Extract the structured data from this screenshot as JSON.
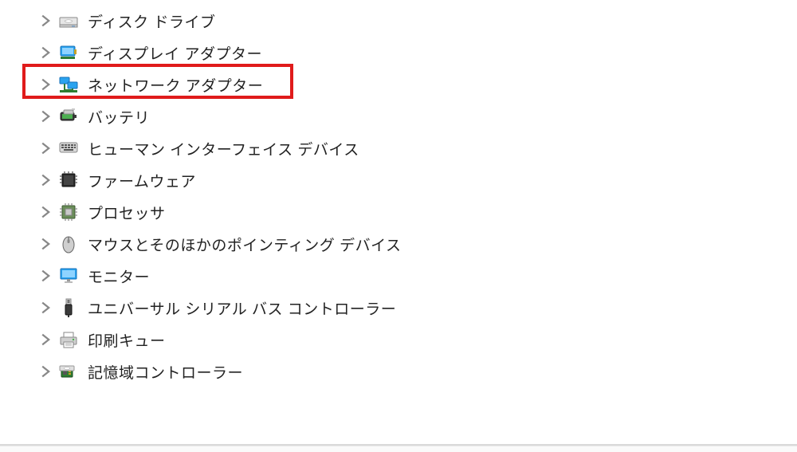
{
  "device_categories": [
    {
      "id": "disk-drives",
      "label": "ディスク ドライブ",
      "icon": "disk-drive-icon"
    },
    {
      "id": "display-adapters",
      "label": "ディスプレイ アダプター",
      "icon": "display-adapter-icon"
    },
    {
      "id": "network-adapters",
      "label": "ネットワーク アダプター",
      "icon": "network-adapter-icon",
      "highlighted": true
    },
    {
      "id": "batteries",
      "label": "バッテリ",
      "icon": "battery-icon"
    },
    {
      "id": "hid",
      "label": "ヒューマン インターフェイス デバイス",
      "icon": "hid-icon"
    },
    {
      "id": "firmware",
      "label": "ファームウェア",
      "icon": "firmware-icon"
    },
    {
      "id": "processors",
      "label": "プロセッサ",
      "icon": "processor-icon"
    },
    {
      "id": "mice",
      "label": "マウスとそのほかのポインティング デバイス",
      "icon": "mouse-icon"
    },
    {
      "id": "monitors",
      "label": "モニター",
      "icon": "monitor-icon"
    },
    {
      "id": "usb-controllers",
      "label": "ユニバーサル シリアル バス コントローラー",
      "icon": "usb-icon"
    },
    {
      "id": "print-queues",
      "label": "印刷キュー",
      "icon": "printer-icon"
    },
    {
      "id": "storage-ctrl",
      "label": "記憶域コントローラー",
      "icon": "storage-controller-icon"
    }
  ],
  "highlight_color": "#e01b1b"
}
